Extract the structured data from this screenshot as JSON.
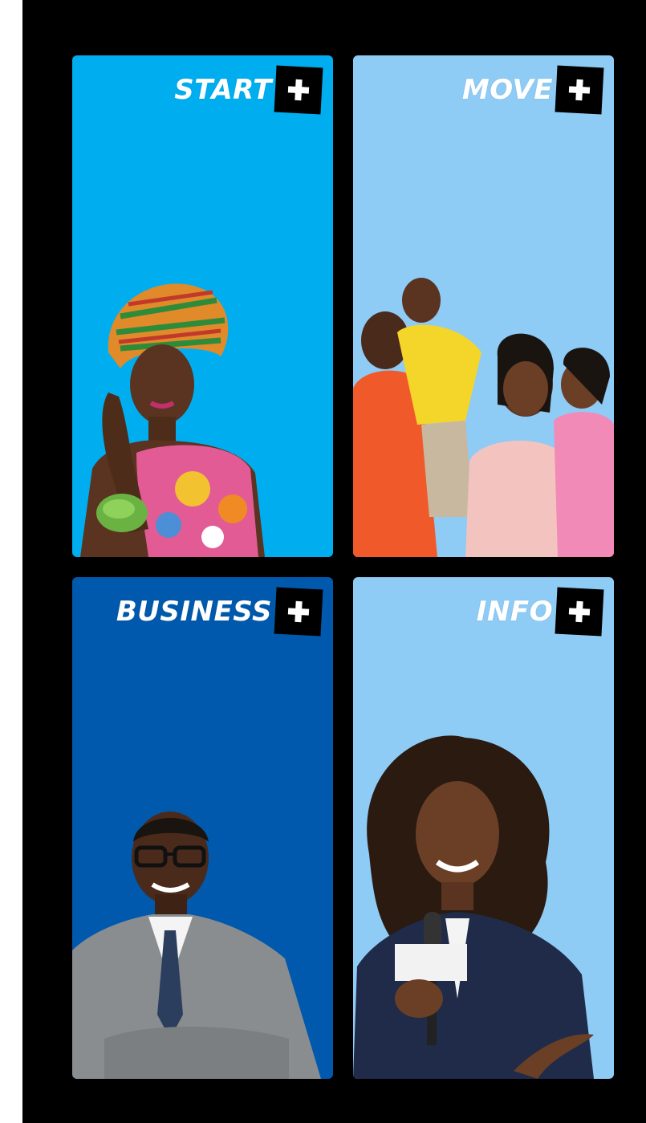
{
  "tiles": [
    {
      "id": "start",
      "label": "START",
      "color": "#00aeef",
      "photo": "woman-in-headwrap-photo"
    },
    {
      "id": "move",
      "label": "MOVE",
      "color": "#8ecbf5",
      "photo": "family-photo"
    },
    {
      "id": "business",
      "label": "BUSINESS",
      "color": "#0059ac",
      "photo": "businessman-photo"
    },
    {
      "id": "info",
      "label": "INFO",
      "color": "#8ecbf5",
      "photo": "reporter-with-microphone-photo"
    }
  ],
  "icons": {
    "plus": "plus-icon"
  }
}
